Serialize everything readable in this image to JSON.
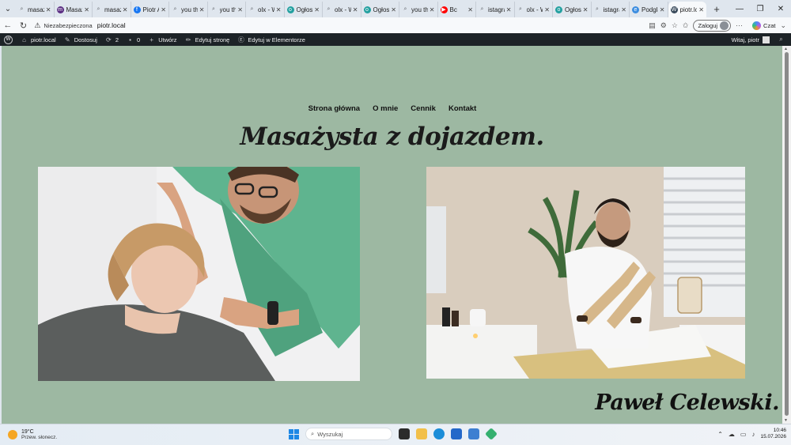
{
  "browser": {
    "tabs": [
      {
        "label": "masaż",
        "icon": "search-icon",
        "color": "#5f6368"
      },
      {
        "label": "Masaż",
        "icon": "bookmark-icon",
        "color": "#5a2d82"
      },
      {
        "label": "masaż",
        "icon": "search-icon",
        "color": "#5f6368"
      },
      {
        "label": "Piotr A",
        "icon": "facebook-icon",
        "color": "#1877f2"
      },
      {
        "label": "you th",
        "icon": "search-icon",
        "color": "#5f6368"
      },
      {
        "label": "you th",
        "icon": "search-icon",
        "color": "#5f6368"
      },
      {
        "label": "olx - W",
        "icon": "search-icon",
        "color": "#5f6368"
      },
      {
        "label": "Ogłos",
        "icon": "olx-icon",
        "color": "#23a0a0"
      },
      {
        "label": "olx - W",
        "icon": "search-icon",
        "color": "#5f6368"
      },
      {
        "label": "Ogłos",
        "icon": "olx-icon",
        "color": "#23a0a0"
      },
      {
        "label": "you th",
        "icon": "search-icon",
        "color": "#5f6368"
      },
      {
        "label": "Bc",
        "icon": "youtube-icon",
        "color": "#ff0000"
      },
      {
        "label": "istagra",
        "icon": "search-icon",
        "color": "#5f6368"
      },
      {
        "label": "olx - W",
        "icon": "search-icon",
        "color": "#5f6368"
      },
      {
        "label": "Ogłos",
        "icon": "olx-icon",
        "color": "#23a0a0"
      },
      {
        "label": "istagra",
        "icon": "search-icon",
        "color": "#5f6368"
      },
      {
        "label": "Podglą",
        "icon": "edge-icon",
        "color": "#3c8de0"
      },
      {
        "label": "piotr.lo",
        "icon": "wordpress-icon",
        "color": "#3a4b5c"
      }
    ],
    "security_label": "Niezabezpieczona",
    "url": "piotr.local",
    "login_label": "Zaloguj",
    "copilot_label": "Czat"
  },
  "wp_admin": {
    "site_name": "piotr.local",
    "customize": "Dostosuj",
    "updates_count": "2",
    "comments_count": "0",
    "new_label": "Utwórz",
    "edit_page": "Edytuj stronę",
    "edit_elementor": "Edytuj w Elementorze",
    "greeting": "Witaj, piotr"
  },
  "site": {
    "menu": [
      "Strona główna",
      "O mnie",
      "Cennik",
      "Kontakt"
    ],
    "headline": "Masażysta z dojazdem.",
    "signature": "Paweł Celewski.",
    "bg_color": "#9db8a2"
  },
  "taskbar": {
    "temperature": "19°C",
    "weather": "Przew. słonecz.",
    "search_placeholder": "Wyszukaj",
    "time": "10:46",
    "date": "15.07.2026"
  }
}
